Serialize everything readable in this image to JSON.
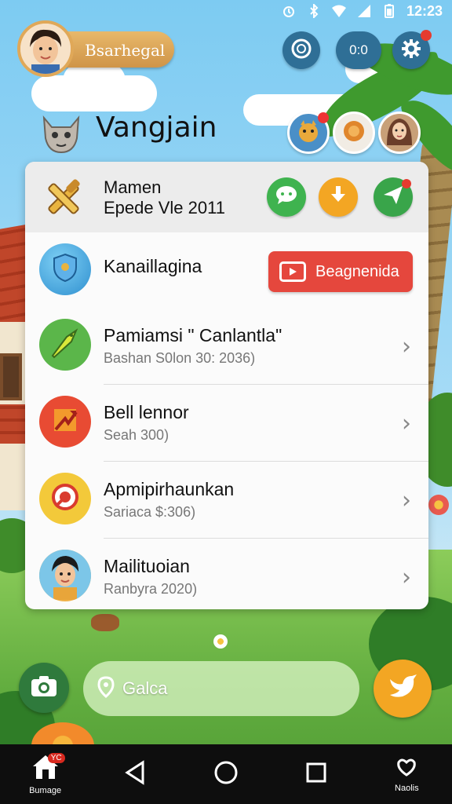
{
  "status_bar": {
    "time": "12:23",
    "icons": [
      "alarm-icon",
      "bluetooth-icon",
      "wifi-icon",
      "signal-icon",
      "battery-icon"
    ]
  },
  "header": {
    "profile_name": "Bsarhegal",
    "help_icon": "help-icon",
    "toggle_label": "0:0",
    "settings_icon": "gear-icon",
    "app_title": "Vangjain"
  },
  "featured": {
    "title": "Mamen",
    "subtitle": "Epede Vle 2011",
    "actions": [
      "chat-icon",
      "download-icon",
      "send-icon"
    ]
  },
  "channel": {
    "label": "Kanaillagina",
    "button_label": "Beagnenida"
  },
  "list": [
    {
      "title": "Pamiamsi \" Canlantla\"",
      "subtitle": "Bashan S0lon 30: 2036)",
      "icon": "arrow-icon",
      "color": "#5bb64a"
    },
    {
      "title": "Bell lennor",
      "subtitle": "Seah 300)",
      "icon": "trending-icon",
      "color": "#e84b33"
    },
    {
      "title": "Apmipirhaunkan",
      "subtitle": "Sariaca $:306)",
      "icon": "target-icon",
      "color": "#f3c93a"
    },
    {
      "title": "Mailituoian",
      "subtitle": "Ranbyra 2020)",
      "icon": "avatar-icon",
      "color": "#f0b24a"
    }
  ],
  "bottom": {
    "search_text": "Galca"
  },
  "nav": {
    "home_label": "Bumage",
    "home_badge": "YC",
    "profile_label": "Naolis"
  },
  "colors": {
    "accent_red": "#e5473d",
    "accent_orange": "#f3a623",
    "nav_bg": "#0e0e0e"
  }
}
